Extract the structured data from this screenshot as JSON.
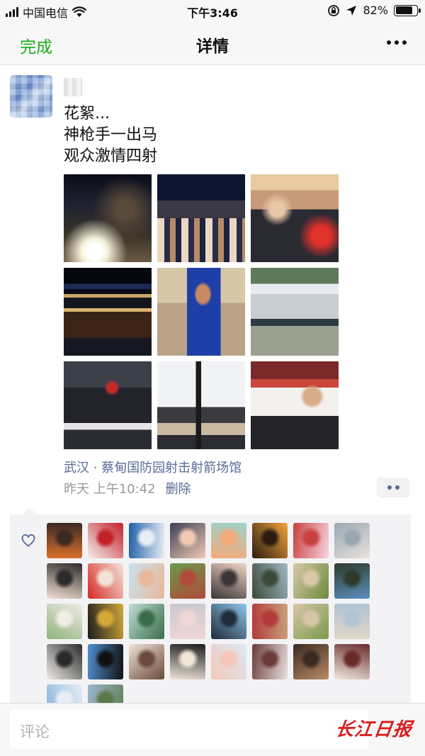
{
  "status_bar": {
    "carrier": "中国电信",
    "time": "下午3:46",
    "battery_text": "82%",
    "battery_level": 0.82
  },
  "nav": {
    "done_label": "完成",
    "title": "详情"
  },
  "post": {
    "lines": [
      "花絮...",
      "神枪手一出马",
      "观众激情四射"
    ],
    "photos": [
      {
        "icon": "photo-stadium-crowd-night"
      },
      {
        "icon": "photo-spectators-stands"
      },
      {
        "icon": "photo-audience-flags"
      },
      {
        "icon": "photo-building-night"
      },
      {
        "icon": "photo-athlete-headphones"
      },
      {
        "icon": "photo-venue-exterior"
      },
      {
        "icon": "photo-crowd-flag-waving"
      },
      {
        "icon": "photo-camera-on-stand"
      },
      {
        "icon": "photo-photographer-crowd"
      }
    ],
    "location": "武汉 · 蔡甸国防园射击射箭场馆",
    "time": "昨天 上午10:42",
    "delete_label": "删除"
  },
  "likes": {
    "count": 34
  },
  "comment": {
    "placeholder": "评论"
  },
  "watermark": {
    "text": "长江日报"
  },
  "colors": {
    "accent_green": "#1aad19",
    "link_blue": "#576b95",
    "watermark_red": "#d71e1e"
  }
}
